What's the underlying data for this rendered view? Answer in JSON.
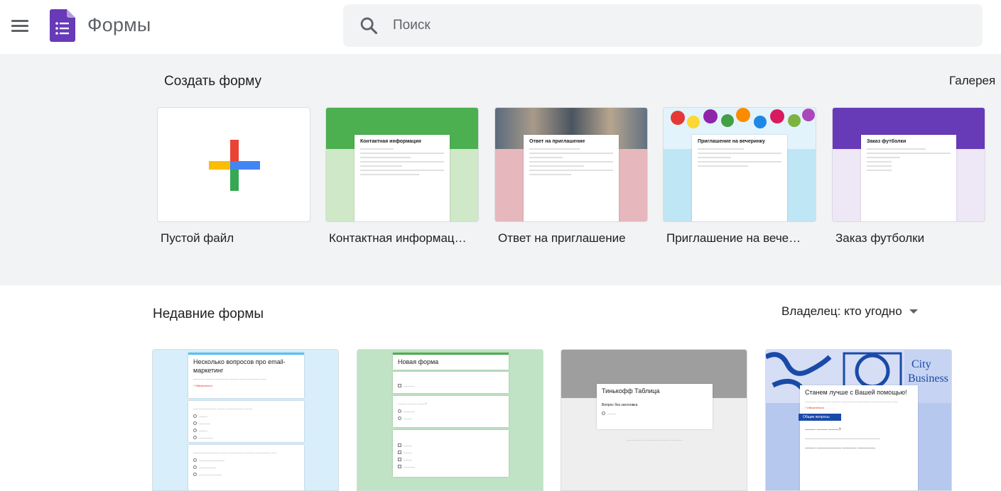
{
  "header": {
    "app_title": "Формы",
    "search_placeholder": "Поиск"
  },
  "templates": {
    "section_title": "Создать форму",
    "gallery_label": "Галерея",
    "items": [
      {
        "label": "Пустой файл"
      },
      {
        "label": "Контактная информац…",
        "thumb_title": "Контактная информация",
        "accent": "#4caf50"
      },
      {
        "label": "Ответ на приглашение",
        "thumb_title": "Ответ на приглашение",
        "accent": "#e6b8bd"
      },
      {
        "label": "Приглашение на вече…",
        "thumb_title": "Приглашение на вечеринку",
        "accent": "#bfe6f5"
      },
      {
        "label": "Заказ футболки",
        "thumb_title": "Заказ футболки",
        "accent": "#673ab7"
      }
    ]
  },
  "recent": {
    "section_title": "Недавние формы",
    "owner_filter": "Владелец: кто угодно",
    "docs": [
      {
        "title": "Несколько вопросов про email-маркетинг",
        "bg": "#d8eefa",
        "accent": "#4fc3f7"
      },
      {
        "title": "Новая форма",
        "bg": "#bfe3c4",
        "accent": "#4caf50"
      },
      {
        "title": "Тинькофф Таблица",
        "question": "Вопрос без заголовка",
        "bg": "#eeeeee",
        "accent": "#9e9e9e"
      },
      {
        "title": "Станем лучше с Вашей помощью!",
        "section": "Общие вопросы",
        "bg": "#b7c8ee",
        "accent": "#1a4aa8"
      }
    ]
  },
  "colors": {
    "header_bg": "#ffffff",
    "band_bg": "#f1f3f4",
    "forms_purple": "#673ab7"
  },
  "icons": {
    "menu": "hamburger-menu-icon",
    "logo": "google-forms-logo-icon",
    "search": "search-icon",
    "plus": "colored-plus-icon",
    "caret": "caret-down-icon"
  }
}
